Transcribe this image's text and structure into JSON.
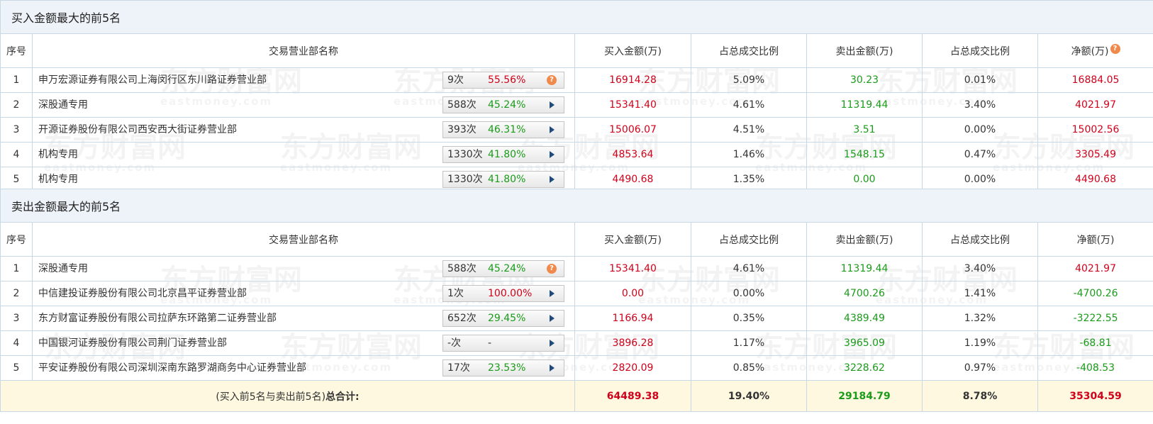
{
  "buy_section": {
    "title": "买入金额最大的前5名",
    "headers": [
      "序号",
      "交易营业部名称",
      "买入金额(万)",
      "占总成交比例",
      "卖出金额(万)",
      "占总成交比例",
      "净额(万)"
    ],
    "header_icon": "question-icon",
    "rows": [
      {
        "no": "1",
        "name": "申万宏源证券有限公司上海闵行区东川路证券营业部",
        "count": "9次",
        "rate": "55.56%",
        "rate_color": "#d0021b",
        "icon": "question-icon",
        "buy": "16914.28",
        "buy_pct": "5.09%",
        "sell": "30.23",
        "sell_pct": "0.01%",
        "net": "16884.05",
        "net_color": "#d0021b"
      },
      {
        "no": "2",
        "name": "深股通专用",
        "count": "588次",
        "rate": "45.24%",
        "rate_color": "#1a9b1a",
        "icon": "arrow-right-icon",
        "buy": "15341.40",
        "buy_pct": "4.61%",
        "sell": "11319.44",
        "sell_pct": "3.40%",
        "net": "4021.97",
        "net_color": "#d0021b"
      },
      {
        "no": "3",
        "name": "开源证券股份有限公司西安西大街证券营业部",
        "count": "393次",
        "rate": "46.31%",
        "rate_color": "#1a9b1a",
        "icon": "arrow-right-icon",
        "buy": "15006.07",
        "buy_pct": "4.51%",
        "sell": "3.51",
        "sell_pct": "0.00%",
        "net": "15002.56",
        "net_color": "#d0021b"
      },
      {
        "no": "4",
        "name": "机构专用",
        "count": "1330次",
        "rate": "41.80%",
        "rate_color": "#1a9b1a",
        "icon": "arrow-right-icon",
        "buy": "4853.64",
        "buy_pct": "1.46%",
        "sell": "1548.15",
        "sell_pct": "0.47%",
        "net": "3305.49",
        "net_color": "#d0021b"
      },
      {
        "no": "5",
        "name": "机构专用",
        "count": "1330次",
        "rate": "41.80%",
        "rate_color": "#1a9b1a",
        "icon": "arrow-right-icon",
        "buy": "4490.68",
        "buy_pct": "1.35%",
        "sell": "0.00",
        "sell_pct": "0.00%",
        "net": "4490.68",
        "net_color": "#d0021b"
      }
    ]
  },
  "sell_section": {
    "title": "卖出金额最大的前5名",
    "headers": [
      "序号",
      "交易营业部名称",
      "买入金额(万)",
      "占总成交比例",
      "卖出金额(万)",
      "占总成交比例",
      "净额(万)"
    ],
    "rows": [
      {
        "no": "1",
        "name": "深股通专用",
        "count": "588次",
        "rate": "45.24%",
        "rate_color": "#1a9b1a",
        "icon": "question-icon",
        "buy": "15341.40",
        "buy_pct": "4.61%",
        "sell": "11319.44",
        "sell_pct": "3.40%",
        "net": "4021.97",
        "net_color": "#d0021b"
      },
      {
        "no": "2",
        "name": "中信建投证券股份有限公司北京昌平证券营业部",
        "count": "1次",
        "rate": "100.00%",
        "rate_color": "#d0021b",
        "icon": "arrow-right-icon",
        "buy": "0.00",
        "buy_pct": "0.00%",
        "sell": "4700.26",
        "sell_pct": "1.41%",
        "net": "-4700.26",
        "net_color": "#1a9b1a"
      },
      {
        "no": "3",
        "name": "东方财富证券股份有限公司拉萨东环路第二证券营业部",
        "count": "652次",
        "rate": "29.45%",
        "rate_color": "#1a9b1a",
        "icon": "arrow-right-icon",
        "buy": "1166.94",
        "buy_pct": "0.35%",
        "sell": "4389.49",
        "sell_pct": "1.32%",
        "net": "-3222.55",
        "net_color": "#1a9b1a"
      },
      {
        "no": "4",
        "name": "中国银河证券股份有限公司荆门证券营业部",
        "count": "-次",
        "rate": "-",
        "rate_color": "#333333",
        "icon": "arrow-right-icon",
        "buy": "3896.28",
        "buy_pct": "1.17%",
        "sell": "3965.09",
        "sell_pct": "1.19%",
        "net": "-68.81",
        "net_color": "#1a9b1a"
      },
      {
        "no": "5",
        "name": "平安证券股份有限公司深圳深南东路罗湖商务中心证券营业部",
        "count": "17次",
        "rate": "23.53%",
        "rate_color": "#1a9b1a",
        "icon": "arrow-right-icon",
        "buy": "2820.09",
        "buy_pct": "0.85%",
        "sell": "3228.62",
        "sell_pct": "0.97%",
        "net": "-408.53",
        "net_color": "#1a9b1a"
      }
    ]
  },
  "total": {
    "label_prefix": "(买入前5名与卖出前5名)",
    "label_bold": "总合计:",
    "buy": "64489.38",
    "buy_pct": "19.40%",
    "sell": "29184.79",
    "sell_pct": "8.78%",
    "net": "35304.59"
  },
  "watermark": {
    "cn": "东方财富网",
    "en": "eastmoney.com"
  },
  "colors": {
    "red": "#d0021b",
    "green": "#1a9b1a",
    "header_bg": "#edf3f9",
    "total_bg": "#fdf8df",
    "border": "#c8d8e4"
  }
}
